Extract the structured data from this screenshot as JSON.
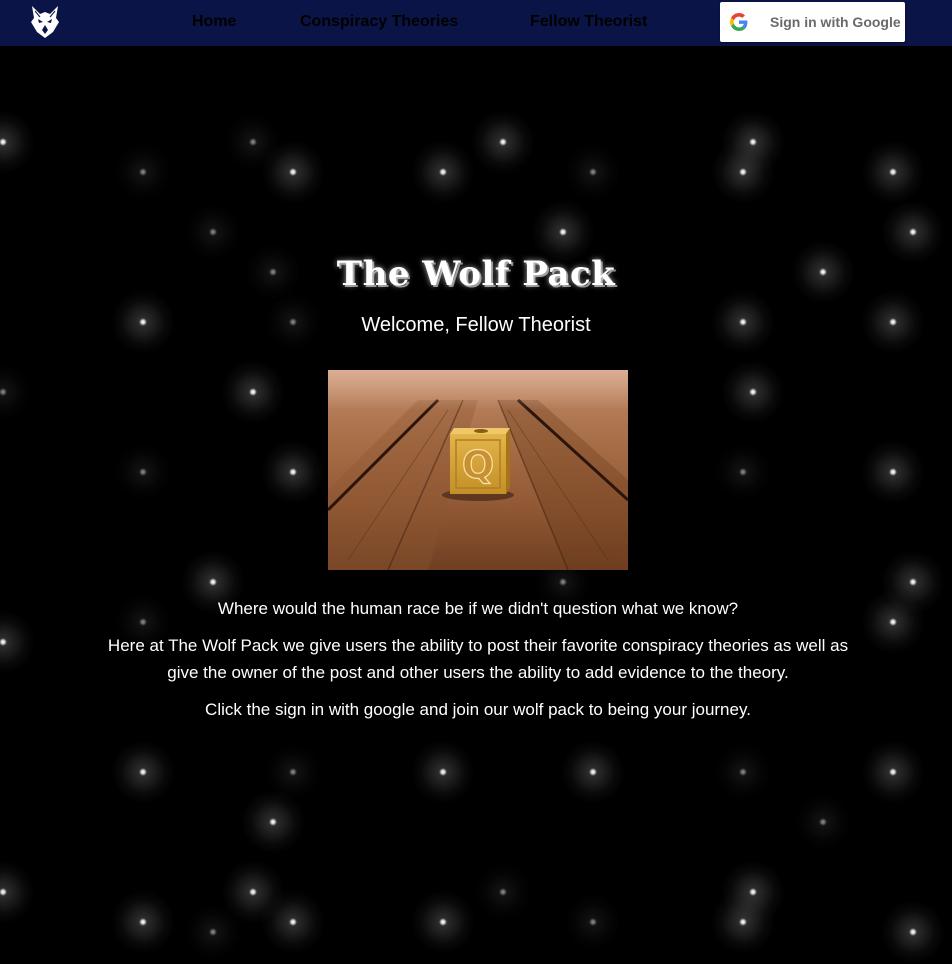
{
  "nav": {
    "links": [
      "Home",
      "Conspiracy Theories",
      "Fellow Theorist"
    ],
    "signin_label": "Sign in with Google"
  },
  "hero": {
    "title": "The Wolf Pack",
    "subtitle": "Welcome, Fellow Theorist",
    "image_icon": "toy-block-q-image"
  },
  "content": {
    "question": "Where would the human race be if we didn't question what we know?",
    "description": "Here at The Wolf Pack we give users the ability to post their favorite conspiracy theories as well as give the owner of the post and other users the ability to add evidence to the theory.",
    "cta": "Click the sign in with google and join our wolf pack to being your journey."
  },
  "colors": {
    "navbar_bg": "#0b1446",
    "page_bg": "#000000",
    "text": "#ffffff"
  },
  "icons": {
    "logo": "wolf-logo-icon",
    "google": "google-icon"
  }
}
